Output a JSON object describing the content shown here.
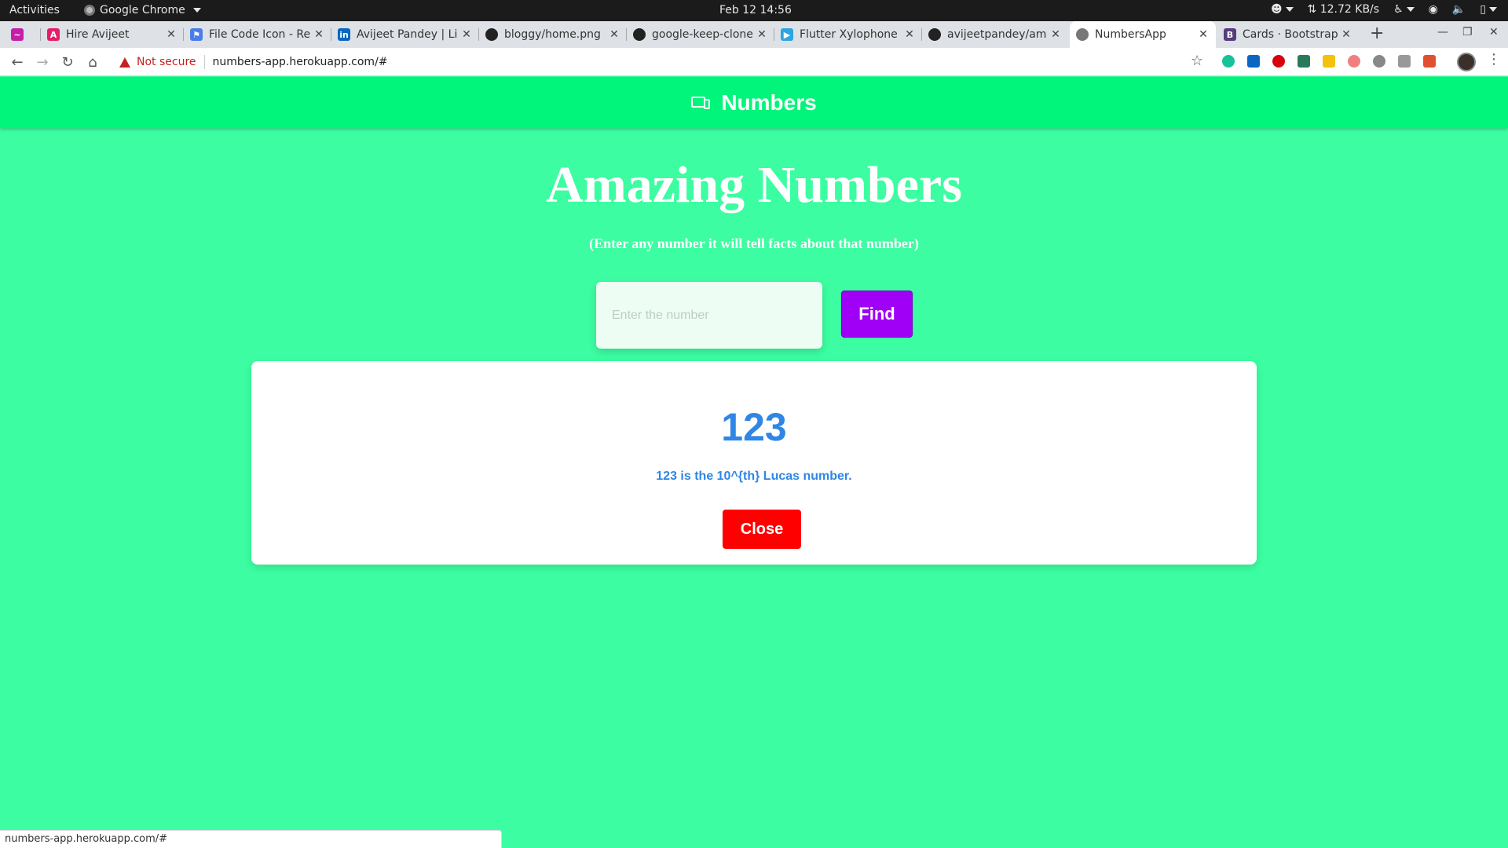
{
  "system_bar": {
    "activities": "Activities",
    "app_name": "Google Chrome",
    "clock": "Feb 12  14:56",
    "network_speed": "⇅ 12.72 KB/s"
  },
  "tabs": [
    {
      "title": "",
      "icon": "pink-chart-icon",
      "color": "#c51fa8"
    },
    {
      "title": "Hire Avijeet",
      "icon": "pink-a-icon",
      "color": "#e41e6a"
    },
    {
      "title": "File Code Icon - Re",
      "icon": "flag-icon",
      "color": "#4a7de8"
    },
    {
      "title": "Avijeet Pandey | Li",
      "icon": "linkedin-icon",
      "color": "#0a66c2"
    },
    {
      "title": "bloggy/home.png",
      "icon": "github-icon",
      "color": "#222222"
    },
    {
      "title": "google-keep-clone",
      "icon": "github-icon",
      "color": "#222222"
    },
    {
      "title": "Flutter Xylophone",
      "icon": "play-store-icon",
      "color": "#2ca5e0"
    },
    {
      "title": "avijeetpandey/am",
      "icon": "github-icon",
      "color": "#222222"
    },
    {
      "title": "NumbersApp",
      "icon": "globe-icon",
      "color": "#777777",
      "active": true
    },
    {
      "title": "Cards · Bootstrap",
      "icon": "bootstrap-icon",
      "color": "#563d7c"
    }
  ],
  "toolbar": {
    "not_secure": "Not secure",
    "url": "numbers-app.herokuapp.com/#"
  },
  "app": {
    "brand": "Numbers",
    "title": "Amazing Numbers",
    "subtitle": "(Enter any number it will tell facts about that number)",
    "input_placeholder": "Enter the number",
    "input_value": "",
    "find_label": "Find",
    "result_number": "123",
    "result_fact": "123 is the 10^{th} Lucas number.",
    "close_label": "Close"
  },
  "status_url": "numbers-app.herokuapp.com/#",
  "colors": {
    "page_bg": "#3cfda1",
    "nav_bg": "#00f57a",
    "find_btn": "#a000f5",
    "close_btn": "#ff0000",
    "result_text": "#2f86e5"
  }
}
